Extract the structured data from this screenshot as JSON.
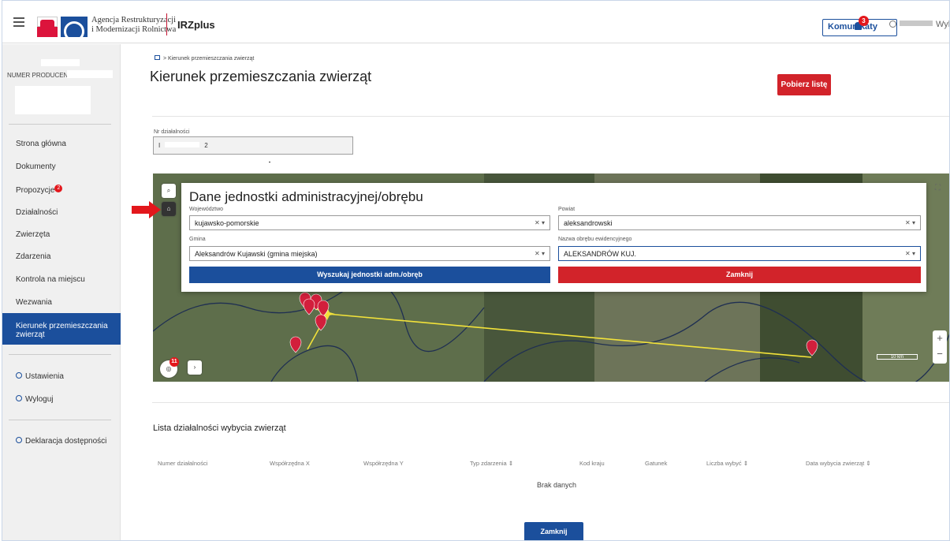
{
  "header": {
    "agency_line1": "Agencja Restrukturyzacji",
    "agency_line2": "i Modernizacji Rolnictwa",
    "app_name": "IRZplus",
    "komunikaty_label": "Komunikaty",
    "komunikaty_count": "3",
    "user_suffix": "Wylog"
  },
  "sidebar": {
    "producer_label": "NUMER PRODUCENTA:",
    "nav_items": [
      {
        "label": "Strona główna"
      },
      {
        "label": "Dokumenty"
      },
      {
        "label": "Propozycje",
        "badge": "2"
      },
      {
        "label": "Działalności"
      },
      {
        "label": "Zwierzęta"
      },
      {
        "label": "Zdarzenia"
      },
      {
        "label": "Kontrola na miejscu"
      },
      {
        "label": "Wezwania"
      },
      {
        "label": "Kierunek przemieszczania zwierząt",
        "active": true
      }
    ],
    "ustawienia": "Ustawienia",
    "wyloguj": "Wyloguj",
    "deklaracja": "Deklaracja dostępności"
  },
  "breadcrumb": {
    "current": "Kierunek przemieszczania zwierząt"
  },
  "page_title": "Kierunek przemieszczania zwierząt",
  "pobierz_button": "Pobierz listę",
  "nr_dzialalnosci": {
    "label": "Nr działalności",
    "value_suffix": "2"
  },
  "map": {
    "layers_count": "11",
    "scale_label": "10 km",
    "zoom_in": "+",
    "zoom_out": "−"
  },
  "admin_panel": {
    "title": "Dane jednostki administracyjnej/obrębu",
    "wojewodztwo_label": "Województwo",
    "wojewodztwo_value": "kujawsko-pomorskie",
    "powiat_label": "Powiat",
    "powiat_value": "aleksandrowski",
    "gmina_label": "Gmina",
    "gmina_value": "Aleksandrów Kujawski (gmina miejska)",
    "obreb_label": "Nazwa obrębu ewidencyjnego",
    "obreb_value": "ALEKSANDRÓW KUJ.",
    "search_button": "Wyszukaj jednostki adm./obręb",
    "close_button": "Zamknij"
  },
  "list": {
    "title": "Lista działalności wybycia zwierząt",
    "columns": [
      "Numer działalności",
      "Współrzędna X",
      "Współrzędna Y",
      "Typ zdarzenia",
      "Kod kraju",
      "Gatunek",
      "Liczba wybyć",
      "Data wybycia zwierząt"
    ],
    "empty_text": "Brak danych"
  },
  "bottom_close": "Zamknij",
  "colors": {
    "brand_blue": "#1b4f9c",
    "brand_red": "#d2232a",
    "route_yellow": "#f2e23a"
  }
}
